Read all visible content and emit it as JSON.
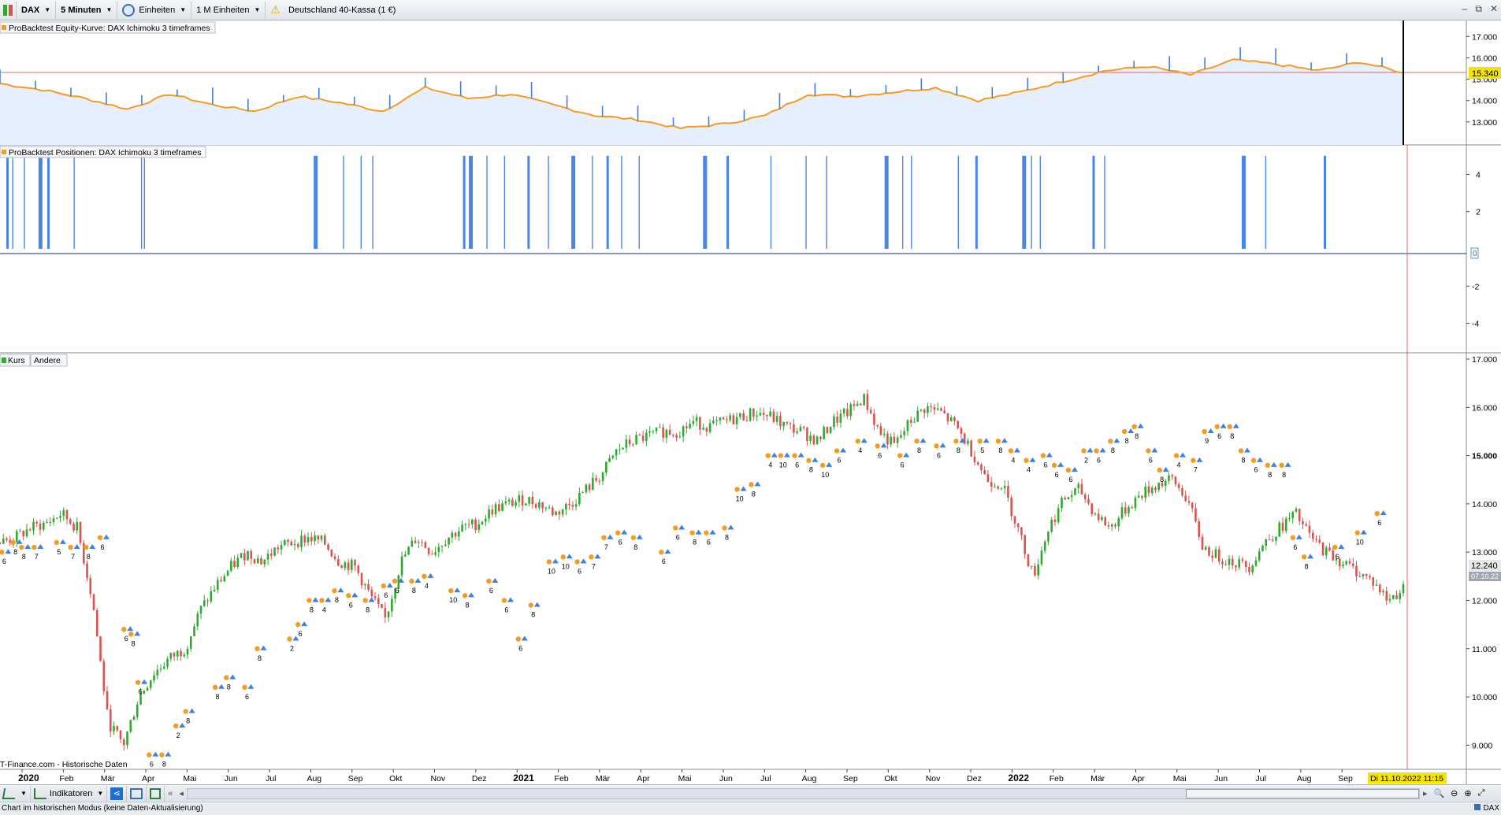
{
  "toolbar": {
    "symbol": "DAX",
    "timeframe": "5 Minuten",
    "units": "Einheiten",
    "units_count": "1 M Einheiten",
    "instrument": "Deutschland 40-Kassa (1 €)"
  },
  "window_controls": [
    "–",
    "⧉",
    "✕"
  ],
  "panels": {
    "equity_label": "ProBacktest Equity-Kurve: DAX Ichimoku 3 timeframes",
    "positions_label": "ProBacktest Positionen: DAX Ichimoku 3 timeframes",
    "price_tab_1": "Kurs",
    "price_tab_2": "Andere"
  },
  "source_text": "IT-Finance.com - Historische Daten",
  "cursor_date": "Di 11.10.2022 11:15",
  "bottom_toolbar": {
    "indicators": "Indikatoren"
  },
  "status": {
    "left": "Chart im historischen Modus (keine Daten-Aktualisierung)",
    "right": "DAX"
  },
  "colors": {
    "equity_line": "#f39c1f",
    "equity_up": "#3d7fe6",
    "equity_fill": "#e6efff",
    "bar_blue": "#4a86e8",
    "candle_up": "#2eaa2e",
    "candle_down": "#d9534f",
    "ref_line": "#e06666"
  },
  "chart_data": [
    {
      "type": "area",
      "name": "equity",
      "y_ticks": [
        "17.000",
        "16.000",
        "15.000",
        "14.000",
        "13.000"
      ],
      "y_range": [
        12000,
        17600
      ],
      "current_value": "15.340",
      "x": [
        "2020-01",
        "2020-02",
        "2020-03",
        "2020-04",
        "2020-05",
        "2020-06",
        "2020-07",
        "2020-08",
        "2020-09",
        "2020-10",
        "2020-11",
        "2020-12",
        "2021-01",
        "2021-02",
        "2021-03",
        "2021-04",
        "2021-05",
        "2021-06",
        "2021-07",
        "2021-08",
        "2021-09",
        "2021-10",
        "2021-11",
        "2021-12",
        "2022-01",
        "2022-02",
        "2022-03",
        "2022-04",
        "2022-05",
        "2022-06",
        "2022-07",
        "2022-08",
        "2022-09",
        "2022-10"
      ],
      "values": [
        14800,
        14500,
        14100,
        13600,
        14300,
        13800,
        13500,
        14200,
        13900,
        13500,
        14600,
        14100,
        14300,
        13800,
        13300,
        13100,
        12700,
        12900,
        13300,
        14300,
        14200,
        14400,
        14600,
        14000,
        14400,
        14900,
        15400,
        15600,
        15200,
        15900,
        15700,
        15400,
        15800,
        15300
      ]
    },
    {
      "type": "bar",
      "name": "positions",
      "y_ticks": [
        "4",
        "2",
        "0",
        "-2",
        "-4"
      ],
      "y_range": [
        -5.5,
        5.5
      ],
      "bars": [
        [
          2020.0,
          5
        ],
        [
          2020.02,
          5
        ],
        [
          2020.06,
          5
        ],
        [
          2020.11,
          5
        ],
        [
          2020.14,
          5
        ],
        [
          2020.23,
          5
        ],
        [
          2020.46,
          5
        ],
        [
          2020.47,
          5
        ],
        [
          2021.05,
          5
        ],
        [
          2021.15,
          5
        ],
        [
          2021.21,
          5
        ],
        [
          2021.25,
          5
        ],
        [
          2021.56,
          5
        ],
        [
          2021.58,
          5
        ],
        [
          2021.64,
          5
        ],
        [
          2021.7,
          5
        ],
        [
          2021.78,
          5
        ],
        [
          2021.85,
          5
        ],
        [
          2021.93,
          5
        ],
        [
          2022.0,
          5
        ],
        [
          2022.05,
          5
        ],
        [
          2022.1,
          5
        ],
        [
          2022.16,
          5
        ],
        [
          2022.38,
          5
        ],
        [
          2022.46,
          5
        ],
        [
          2022.61,
          5
        ],
        [
          2022.73,
          5
        ],
        [
          2022.8,
          5
        ],
        [
          2023.0,
          5
        ],
        [
          2023.06,
          5
        ],
        [
          2023.09,
          5
        ],
        [
          2023.25,
          5
        ],
        [
          2023.31,
          5
        ],
        [
          2023.47,
          5
        ],
        [
          2023.5,
          5
        ],
        [
          2023.53,
          5
        ],
        [
          2023.71,
          5
        ],
        [
          2023.75,
          5
        ],
        [
          2024.22,
          5
        ],
        [
          2024.3,
          5
        ],
        [
          2024.5,
          5
        ]
      ],
      "zero_label": "0"
    },
    {
      "type": "candlestick",
      "name": "Kurs",
      "y_ticks": [
        "17.000",
        "16.000",
        "15.000",
        "14.000",
        "13.000",
        "12.000",
        "11.000",
        "10.000",
        "9.000"
      ],
      "y_range": [
        8500,
        17000
      ],
      "last_price": "12.240",
      "last_date": "07.10.22",
      "x_labels": [
        "2020",
        "Feb",
        "Mär",
        "Apr",
        "Mai",
        "Jun",
        "Jul",
        "Aug",
        "Sep",
        "Okt",
        "Nov",
        "Dez",
        "2021",
        "Feb",
        "Mär",
        "Apr",
        "Mai",
        "Jun",
        "Jul",
        "Aug",
        "Sep",
        "Okt",
        "Nov",
        "Dez",
        "2022",
        "Feb",
        "Mär",
        "Apr",
        "Mai",
        "Jun",
        "Jul",
        "Aug",
        "Sep"
      ],
      "close_path": [
        13200,
        13300,
        13500,
        13600,
        13800,
        13500,
        12000,
        9500,
        9000,
        10000,
        10500,
        10800,
        11000,
        11800,
        12300,
        12700,
        13000,
        12800,
        13100,
        13200,
        13300,
        13200,
        12800,
        12700,
        12100,
        11600,
        12800,
        13300,
        13000,
        13300,
        13500,
        13600,
        13900,
        14000,
        14100,
        14000,
        13800,
        14000,
        14300,
        14600,
        15100,
        15300,
        15400,
        15500,
        15500,
        15700,
        15600,
        15700,
        15800,
        15900,
        15800,
        15600,
        15500,
        15300,
        15700,
        15900,
        16200,
        15500,
        15200,
        15700,
        16000,
        15900,
        15600,
        15100,
        14500,
        14400,
        13500,
        12500,
        13500,
        14100,
        14300,
        13800,
        13500,
        13900,
        14200,
        14400,
        14500,
        14100,
        13100,
        12900,
        12800,
        12700,
        13200,
        13500,
        13800,
        13300,
        13000,
        12800,
        12600,
        12400,
        12000,
        12240
      ],
      "signals": [
        {
          "x": 0.003,
          "y": 13000,
          "label": "6"
        },
        {
          "x": 0.011,
          "y": 13200,
          "label": "8"
        },
        {
          "x": 0.017,
          "y": 13100,
          "label": "8"
        },
        {
          "x": 0.026,
          "y": 13100,
          "label": "7"
        },
        {
          "x": 0.042,
          "y": 13200,
          "label": "5"
        },
        {
          "x": 0.052,
          "y": 13100,
          "label": "7"
        },
        {
          "x": 0.063,
          "y": 13100,
          "label": "8"
        },
        {
          "x": 0.073,
          "y": 13300,
          "label": "6"
        },
        {
          "x": 0.09,
          "y": 11400,
          "label": "6"
        },
        {
          "x": 0.095,
          "y": 11300,
          "label": "8"
        },
        {
          "x": 0.1,
          "y": 10300,
          "label": "6"
        },
        {
          "x": 0.108,
          "y": 8800,
          "label": "6"
        },
        {
          "x": 0.117,
          "y": 8800,
          "label": "8"
        },
        {
          "x": 0.127,
          "y": 9400,
          "label": "2"
        },
        {
          "x": 0.134,
          "y": 9700,
          "label": "8"
        },
        {
          "x": 0.155,
          "y": 10200,
          "label": "8"
        },
        {
          "x": 0.163,
          "y": 10400,
          "label": "8"
        },
        {
          "x": 0.176,
          "y": 10200,
          "label": "6"
        },
        {
          "x": 0.185,
          "y": 11000,
          "label": "8"
        },
        {
          "x": 0.208,
          "y": 11200,
          "label": "2"
        },
        {
          "x": 0.214,
          "y": 11500,
          "label": "6"
        },
        {
          "x": 0.222,
          "y": 12000,
          "label": "8"
        },
        {
          "x": 0.231,
          "y": 12000,
          "label": "4"
        },
        {
          "x": 0.24,
          "y": 12200,
          "label": "8"
        },
        {
          "x": 0.25,
          "y": 12100,
          "label": "6"
        },
        {
          "x": 0.262,
          "y": 12000,
          "label": "8"
        },
        {
          "x": 0.275,
          "y": 12300,
          "label": "6"
        },
        {
          "x": 0.283,
          "y": 12400,
          "label": "6"
        },
        {
          "x": 0.295,
          "y": 12400,
          "label": "8"
        },
        {
          "x": 0.304,
          "y": 12500,
          "label": "4"
        },
        {
          "x": 0.323,
          "y": 12200,
          "label": "10"
        },
        {
          "x": 0.333,
          "y": 12100,
          "label": "8"
        },
        {
          "x": 0.35,
          "y": 12400,
          "label": "6"
        },
        {
          "x": 0.361,
          "y": 12000,
          "label": "6"
        },
        {
          "x": 0.371,
          "y": 11200,
          "label": "6"
        },
        {
          "x": 0.38,
          "y": 11900,
          "label": "8"
        },
        {
          "x": 0.393,
          "y": 12800,
          "label": "10"
        },
        {
          "x": 0.403,
          "y": 12900,
          "label": "10"
        },
        {
          "x": 0.413,
          "y": 12800,
          "label": "6"
        },
        {
          "x": 0.423,
          "y": 12900,
          "label": "7"
        },
        {
          "x": 0.432,
          "y": 13300,
          "label": "7"
        },
        {
          "x": 0.442,
          "y": 13400,
          "label": "6"
        },
        {
          "x": 0.453,
          "y": 13300,
          "label": "8"
        },
        {
          "x": 0.473,
          "y": 13000,
          "label": "6"
        },
        {
          "x": 0.483,
          "y": 13500,
          "label": "6"
        },
        {
          "x": 0.495,
          "y": 13400,
          "label": "8"
        },
        {
          "x": 0.505,
          "y": 13400,
          "label": "6"
        },
        {
          "x": 0.518,
          "y": 13500,
          "label": "8"
        },
        {
          "x": 0.527,
          "y": 14300,
          "label": "10"
        },
        {
          "x": 0.537,
          "y": 14400,
          "label": "8"
        },
        {
          "x": 0.549,
          "y": 15000,
          "label": "4"
        },
        {
          "x": 0.558,
          "y": 15000,
          "label": "10"
        },
        {
          "x": 0.568,
          "y": 15000,
          "label": "6"
        },
        {
          "x": 0.578,
          "y": 14900,
          "label": "8"
        },
        {
          "x": 0.588,
          "y": 14800,
          "label": "10"
        },
        {
          "x": 0.598,
          "y": 15100,
          "label": "6"
        },
        {
          "x": 0.613,
          "y": 15300,
          "label": "4"
        },
        {
          "x": 0.627,
          "y": 15200,
          "label": "6"
        },
        {
          "x": 0.643,
          "y": 15000,
          "label": "6"
        },
        {
          "x": 0.655,
          "y": 15300,
          "label": "8"
        },
        {
          "x": 0.669,
          "y": 15200,
          "label": "6"
        },
        {
          "x": 0.683,
          "y": 15300,
          "label": "8"
        },
        {
          "x": 0.7,
          "y": 15300,
          "label": "5"
        },
        {
          "x": 0.713,
          "y": 15300,
          "label": "8"
        },
        {
          "x": 0.722,
          "y": 15100,
          "label": "4"
        },
        {
          "x": 0.733,
          "y": 14900,
          "label": "4"
        },
        {
          "x": 0.745,
          "y": 15000,
          "label": "6"
        },
        {
          "x": 0.753,
          "y": 14800,
          "label": "6"
        },
        {
          "x": 0.763,
          "y": 14700,
          "label": "6"
        },
        {
          "x": 0.774,
          "y": 15100,
          "label": "2"
        },
        {
          "x": 0.783,
          "y": 15100,
          "label": "6"
        },
        {
          "x": 0.793,
          "y": 15300,
          "label": "8"
        },
        {
          "x": 0.803,
          "y": 15500,
          "label": "8"
        },
        {
          "x": 0.81,
          "y": 15600,
          "label": "8"
        },
        {
          "x": 0.82,
          "y": 15100,
          "label": "6"
        },
        {
          "x": 0.828,
          "y": 14700,
          "label": "8"
        },
        {
          "x": 0.84,
          "y": 15000,
          "label": "4"
        },
        {
          "x": 0.852,
          "y": 14900,
          "label": "7"
        },
        {
          "x": 0.86,
          "y": 15500,
          "label": "9"
        },
        {
          "x": 0.869,
          "y": 15600,
          "label": "6"
        },
        {
          "x": 0.878,
          "y": 15600,
          "label": "8"
        },
        {
          "x": 0.886,
          "y": 15100,
          "label": "8"
        },
        {
          "x": 0.895,
          "y": 14900,
          "label": "6"
        },
        {
          "x": 0.905,
          "y": 14800,
          "label": "8"
        },
        {
          "x": 0.915,
          "y": 14800,
          "label": "8"
        },
        {
          "x": 0.923,
          "y": 13300,
          "label": "6"
        },
        {
          "x": 0.931,
          "y": 12900,
          "label": "8"
        },
        {
          "x": 0.953,
          "y": 13100,
          "label": "6"
        },
        {
          "x": 0.969,
          "y": 13400,
          "label": "10"
        },
        {
          "x": 0.983,
          "y": 13800,
          "label": "6"
        }
      ]
    }
  ]
}
